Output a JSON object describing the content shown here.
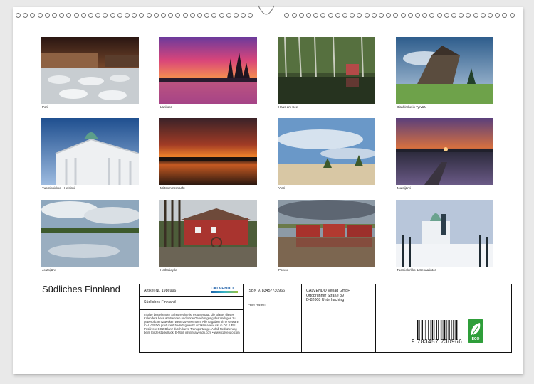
{
  "photos": [
    {
      "caption": "Pori"
    },
    {
      "caption": "Lankoori"
    },
    {
      "caption": "Haus am See"
    },
    {
      "caption": "Olavkirche in Tyrvää"
    },
    {
      "caption": "Tuomiokirkko - Helsinki"
    },
    {
      "caption": "Mittsommernacht"
    },
    {
      "caption": "Yteri"
    },
    {
      "caption": "Joutsijärvi"
    },
    {
      "caption": "Joutsijärvi"
    },
    {
      "caption": "Herbstidylle"
    },
    {
      "caption": "Porvoo"
    },
    {
      "caption": "Tuomiokirkko & Senaatintori"
    }
  ],
  "calendar": {
    "title": "Südliches Finnland",
    "article_no": "Artikel-Nr. 1986996",
    "box_title": "Südliches Finnland",
    "legal_text": "Infolge bestehender Schutzrechte ist es untersagt, die Blätter dieses Kalenders herauszutrennen und ohne Genehmigung des Verlages zu gewerblichen Zwecken weiterzuverwenden. Alle Angaben ohne Gewähr. CALVENDO produziert bedarfsgerecht und klimabewusst in DE & EU. Positivere CO2-Bilanz durch kurze Transportwege. Abfall-Reduzierung beim Einzelstückdruck. E-Mail: info@calvendo.com • www.calvendo.com",
    "isbn": "ISBN 9783457730966",
    "author": "Peter Härlein",
    "publisher": "CALVENDO Verlag GmbH",
    "street": "Ottobrunner Straße 39",
    "city": "D-82008 Unterhaching",
    "logo_text": "CALVENDO",
    "barcode_number": "9 783457 730966",
    "eco_label": "ECO"
  }
}
